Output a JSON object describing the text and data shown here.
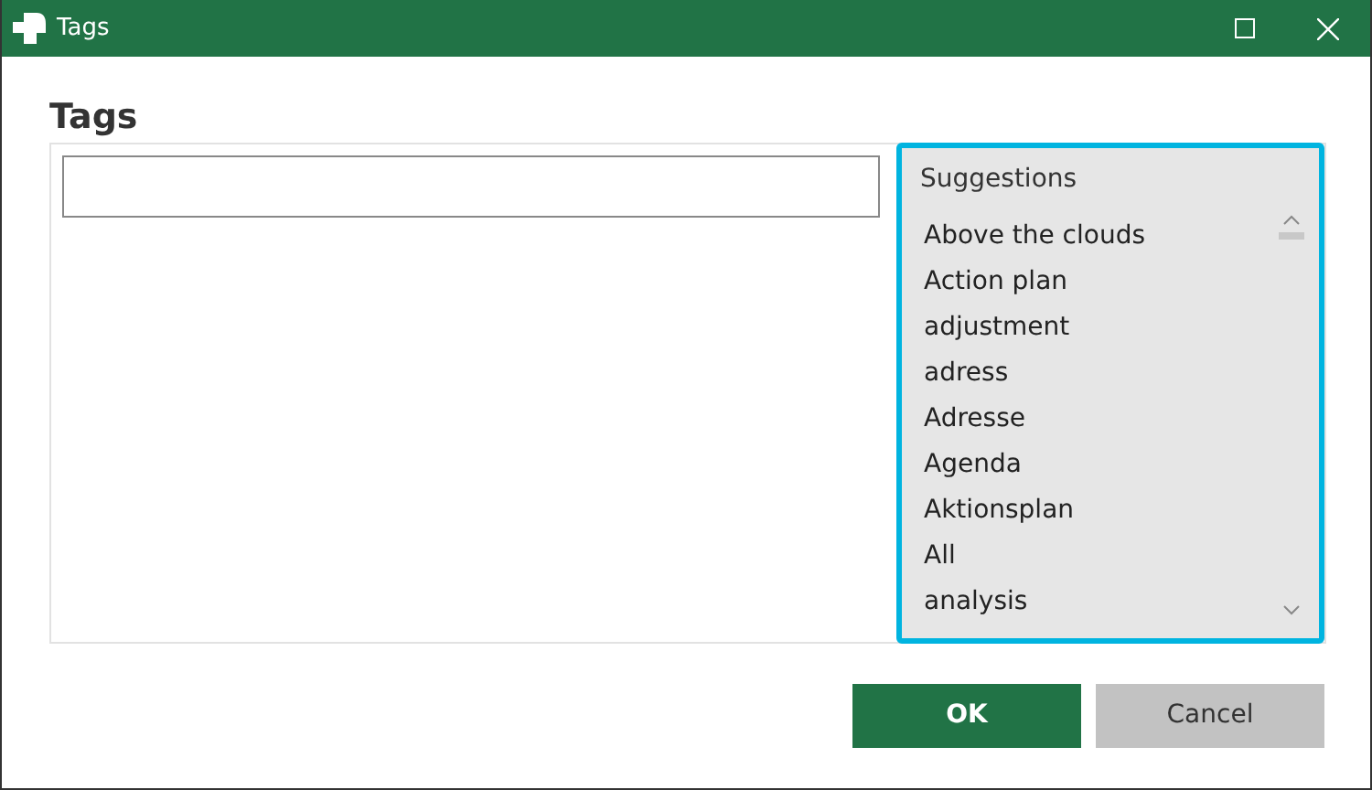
{
  "window": {
    "title": "Tags"
  },
  "heading": "Tags",
  "suggestions": {
    "title": "Suggestions",
    "items": [
      "Above the clouds",
      "Action plan",
      "adjustment",
      "adress",
      "Adresse",
      "Agenda",
      "Aktionsplan",
      "All",
      "analysis"
    ],
    "focused": true
  },
  "buttons": [
    {
      "label": "OK",
      "kind": "primary"
    },
    {
      "label": "Cancel",
      "kind": "secondary"
    }
  ]
}
